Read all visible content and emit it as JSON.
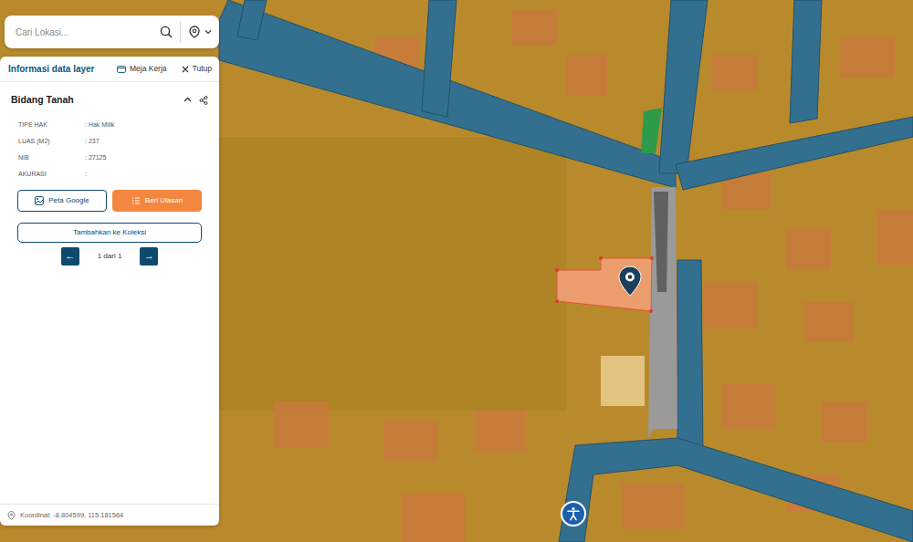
{
  "search": {
    "placeholder": "Cari Lokasi..."
  },
  "panel": {
    "title": "Informasi data layer",
    "actions": [
      {
        "label": "Meja Kerja",
        "kind": "workspace"
      },
      {
        "label": "Tutup",
        "kind": "close"
      }
    ]
  },
  "layer": {
    "title": "Bidang Tanah",
    "expanded": true,
    "fields": [
      {
        "label": "TIPE HAK",
        "value": ": Hak Milik"
      },
      {
        "label": "LUAS (M2)",
        "value": ": 237"
      },
      {
        "label": "NIB",
        "value": ": 27125"
      },
      {
        "label": "AKURASI",
        "value": ":"
      }
    ]
  },
  "buttons": [
    {
      "label": "Peta Google",
      "kind": "outline"
    },
    {
      "label": "Beri Ulasan",
      "kind": "primary"
    }
  ],
  "collection_button": {
    "label": "Tambahkan ke Koleksi"
  },
  "pager": {
    "prev": "←",
    "label": "1 dari 1",
    "next": "→"
  },
  "status_bar": {
    "coordinates": "Koordinat: -8.804599, 115.181564"
  }
}
